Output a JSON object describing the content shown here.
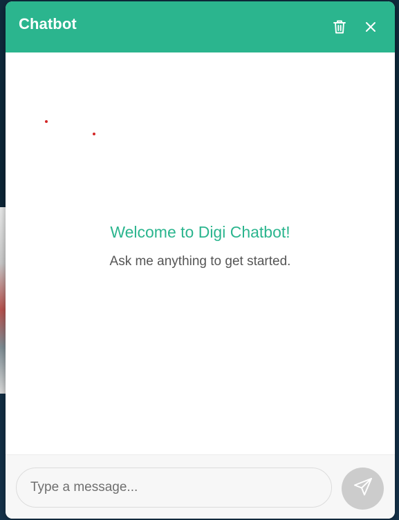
{
  "header": {
    "title": "Chatbot",
    "background_color": "#2bb58e",
    "delete_icon": "trash-icon",
    "close_icon": "close-icon"
  },
  "welcome": {
    "title": "Welcome to Digi Chatbot!",
    "subtitle": "Ask me anything to get started.",
    "title_color": "#2bb58e"
  },
  "composer": {
    "placeholder": "Type a message...",
    "value": "",
    "send_icon": "send-icon",
    "send_button_color": "#cccccc"
  }
}
